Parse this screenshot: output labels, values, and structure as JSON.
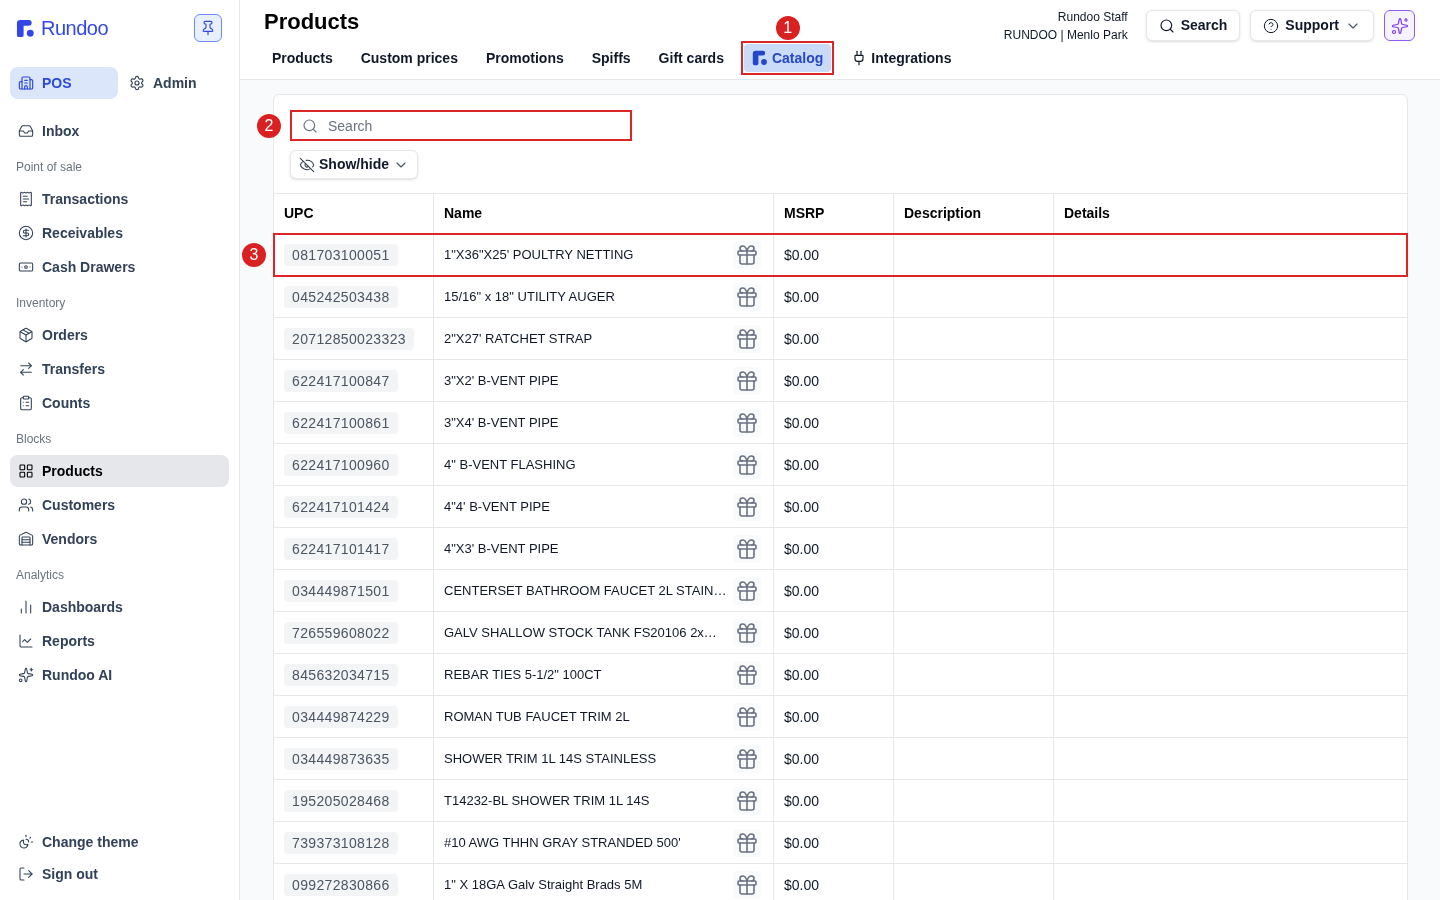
{
  "sidebar": {
    "logo": "Rundoo",
    "pinned": true,
    "modes": [
      {
        "label": "POS",
        "selected": true
      },
      {
        "label": "Admin",
        "selected": false
      }
    ],
    "sections": [
      {
        "items": [
          {
            "label": "Inbox",
            "selected": false
          }
        ]
      },
      {
        "title": "Point of sale",
        "items": [
          {
            "label": "Transactions",
            "selected": false
          },
          {
            "label": "Receivables",
            "selected": false
          },
          {
            "label": "Cash Drawers",
            "selected": false
          }
        ]
      },
      {
        "title": "Inventory",
        "items": [
          {
            "label": "Orders",
            "selected": false
          },
          {
            "label": "Transfers",
            "selected": false
          },
          {
            "label": "Counts",
            "selected": false
          }
        ]
      },
      {
        "title": "Blocks",
        "items": [
          {
            "label": "Products",
            "selected": true
          },
          {
            "label": "Customers",
            "selected": false
          },
          {
            "label": "Vendors",
            "selected": false
          }
        ]
      },
      {
        "title": "Analytics",
        "items": [
          {
            "label": "Dashboards",
            "selected": false
          },
          {
            "label": "Reports",
            "selected": false
          },
          {
            "label": "Rundoo AI",
            "selected": false
          }
        ]
      }
    ],
    "footer_items": [
      {
        "label": "Change theme"
      },
      {
        "label": "Sign out"
      }
    ]
  },
  "header": {
    "title": "Products",
    "tabs": [
      {
        "label": "Products",
        "selected": false
      },
      {
        "label": "Custom prices",
        "selected": false
      },
      {
        "label": "Promotions",
        "selected": false
      },
      {
        "label": "Spiffs",
        "selected": false
      },
      {
        "label": "Gift cards",
        "selected": false
      },
      {
        "label": "Catalog",
        "selected": true,
        "callout": "1"
      },
      {
        "label": "Integrations",
        "selected": false
      }
    ],
    "user": {
      "name": "Rundoo Staff",
      "location": "RUNDOO | Menlo Park"
    },
    "search_button": "Search",
    "support_button": "Support"
  },
  "toolbar": {
    "search": {
      "placeholder": "Search",
      "callout": "2"
    },
    "show_hide_button": "Show/hide"
  },
  "table": {
    "columns": [
      "UPC",
      "Name",
      "MSRP",
      "Description",
      "Details"
    ],
    "rows": [
      {
        "upc": "081703100051",
        "name": "1\"X36\"X25' POULTRY NETTING",
        "msrp": "$0.00",
        "callout": "3"
      },
      {
        "upc": "045242503438",
        "name": "15/16\" x 18\" UTILITY AUGER",
        "msrp": "$0.00"
      },
      {
        "upc": "20712850023323",
        "name": "2\"X27' RATCHET STRAP",
        "msrp": "$0.00"
      },
      {
        "upc": "622417100847",
        "name": "3\"X2' B-VENT PIPE",
        "msrp": "$0.00"
      },
      {
        "upc": "622417100861",
        "name": "3\"X4' B-VENT PIPE",
        "msrp": "$0.00"
      },
      {
        "upc": "622417100960",
        "name": "4\" B-VENT FLASHING",
        "msrp": "$0.00"
      },
      {
        "upc": "622417101424",
        "name": "4\"4' B-VENT PIPE",
        "msrp": "$0.00"
      },
      {
        "upc": "622417101417",
        "name": "4\"X3' B-VENT PIPE",
        "msrp": "$0.00"
      },
      {
        "upc": "034449871501",
        "name": "CENTERSET BATHROOM FAUCET 2L STAIN…",
        "msrp": "$0.00"
      },
      {
        "upc": "726559608022",
        "name": "GALV SHALLOW STOCK TANK FS20106 2x…",
        "msrp": "$0.00"
      },
      {
        "upc": "845632034715",
        "name": "REBAR TIES 5-1/2\" 100CT",
        "msrp": "$0.00"
      },
      {
        "upc": "034449874229",
        "name": "ROMAN TUB FAUCET TRIM 2L",
        "msrp": "$0.00"
      },
      {
        "upc": "034449873635",
        "name": "SHOWER TRIM 1L 14S STAINLESS",
        "msrp": "$0.00"
      },
      {
        "upc": "195205028468",
        "name": "T14232-BL SHOWER TRIM 1L 14S",
        "msrp": "$0.00"
      },
      {
        "upc": "739373108128",
        "name": "#10 AWG THHN GRAY STRANDED 500'",
        "msrp": "$0.00"
      },
      {
        "upc": "099272830866",
        "name": "1\" X 18GA Galv Straight Brads 5M",
        "msrp": "$0.00"
      }
    ]
  }
}
